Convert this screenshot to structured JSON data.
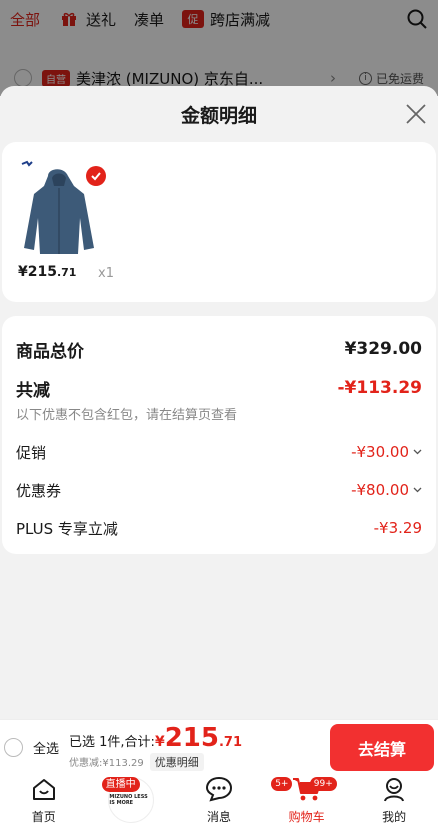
{
  "bg": {
    "tabs": [
      {
        "label": "全部",
        "icon": "",
        "active": true
      },
      {
        "label": "送礼",
        "icon": "gift-icon",
        "active": false
      },
      {
        "label": "凑单",
        "icon": "",
        "active": false
      },
      {
        "label": "跨店满减",
        "icon": "promo-icon",
        "active": false
      }
    ],
    "promo_icon_text": "促",
    "store_tag": "自营",
    "store_name": "美津浓 (MIZUNO) 京东自...",
    "store_arrow": "›",
    "free_shipping": "已免运费",
    "info_icon": "i"
  },
  "sheet": {
    "title": "金额明细",
    "product": {
      "price_int": "¥215",
      "price_dec": ".71",
      "qty": "x1"
    },
    "total": {
      "label": "商品总价",
      "value": "¥329.00"
    },
    "reduce": {
      "label": "共减",
      "value": "-¥113.29"
    },
    "note": "以下优惠不包含红包，请在结算页查看",
    "items": [
      {
        "label": "促销",
        "value": "-¥30.00",
        "expandable": true
      },
      {
        "label": "优惠券",
        "value": "-¥80.00",
        "expandable": true
      },
      {
        "label": "PLUS 专享立减",
        "value": "-¥3.29",
        "expandable": false
      }
    ]
  },
  "checkout": {
    "select_all": "全选",
    "summary": "已选 1件,合计:",
    "currency": "¥",
    "total_int": "215",
    "total_dec": ".71",
    "discount": "优惠减:¥113.29",
    "detail_btn": "优惠明细",
    "submit": "去结算"
  },
  "tabbar": {
    "home": "首页",
    "live_badge": "直播中",
    "live_text": "MIZUNO LESS IS MORE",
    "messages": "消息",
    "messages_badge": "5+",
    "cart": "购物车",
    "cart_badge": "99+",
    "mine": "我的"
  },
  "colors": {
    "accent": "#e2231a",
    "button": "#f23030"
  }
}
